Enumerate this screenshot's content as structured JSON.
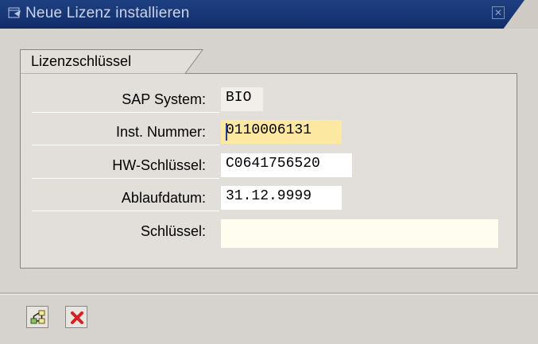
{
  "window": {
    "title": "Neue Lizenz installieren",
    "app_icon": "window-icon",
    "close_icon": "close-icon"
  },
  "group": {
    "title": "Lizenzschlüssel"
  },
  "fields": {
    "sap_system": {
      "label": "SAP System:",
      "value": "BIO"
    },
    "inst_nummer": {
      "label": "Inst. Nummer:",
      "value": "0110006131"
    },
    "hw_schluessel": {
      "label": "HW-Schlüssel:",
      "value": "C0641756520"
    },
    "ablaufdatum": {
      "label": "Ablaufdatum:",
      "value": "31.12.9999"
    },
    "schluessel": {
      "label": "Schlüssel:",
      "value": ""
    }
  },
  "toolbar": {
    "buttons": [
      {
        "icon": "install-tree-icon"
      },
      {
        "icon": "cancel-x-icon"
      }
    ]
  },
  "colors": {
    "titlebar": "#173575",
    "active_field": "#fce8a0",
    "cancel_red": "#d42020"
  }
}
